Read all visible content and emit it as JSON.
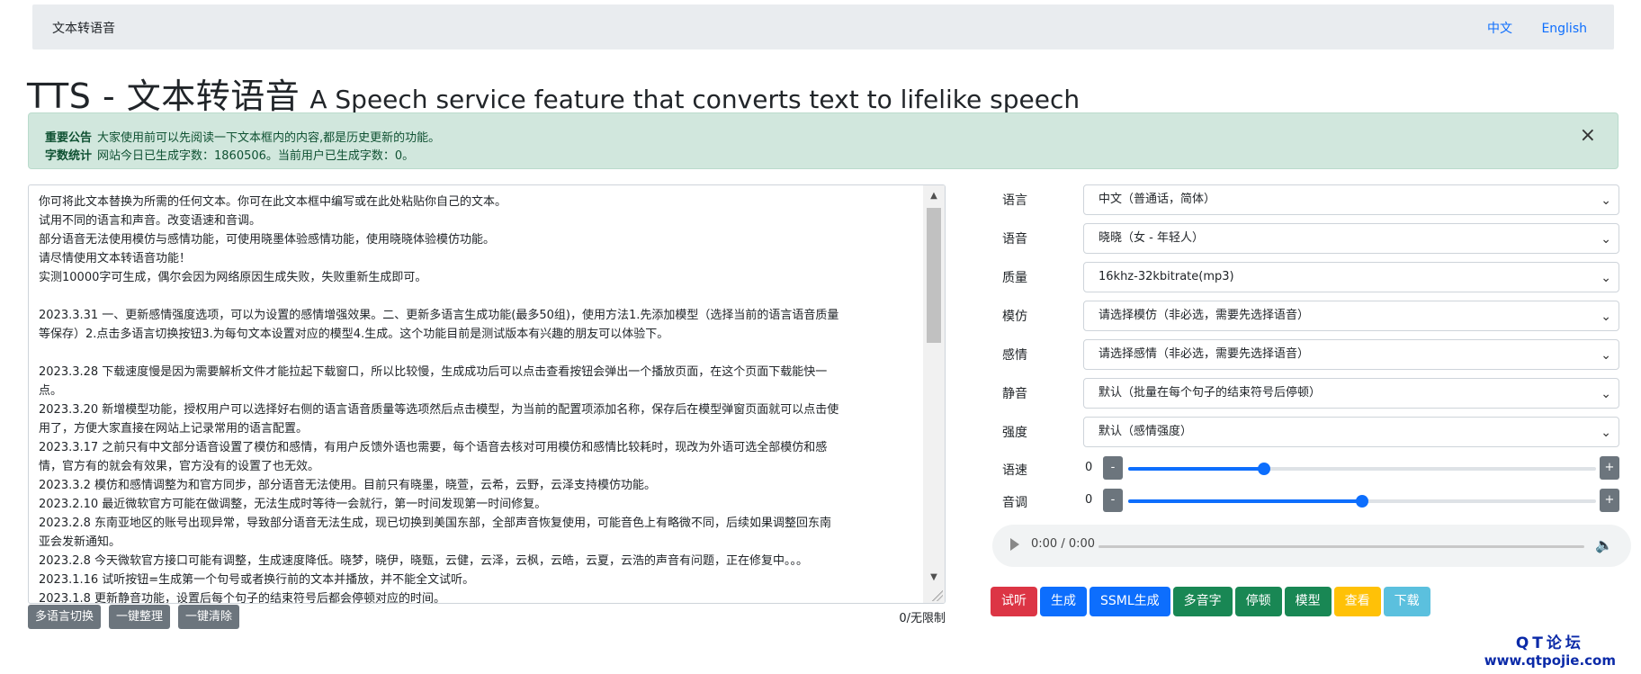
{
  "nav": {
    "brand": "文本转语音",
    "links": [
      "中文",
      "English"
    ]
  },
  "header": {
    "title": "TTS - 文本转语音",
    "subtitle": "A Speech service feature that converts text to lifelike speech"
  },
  "alert": {
    "notice_label": "重要公告",
    "notice_text": "大家使用前可以先阅读一下文本框内的内容,都是历史更新的功能。",
    "stats_label": "字数统计",
    "stats_text": "网站今日已生成字数：1860506。当前用户已生成字数：0。",
    "close": "×"
  },
  "textarea": {
    "lines": [
      "你可将此文本替换为所需的任何文本。你可在此文本框中编写或在此处粘贴你自己的文本。",
      "试用不同的语言和声音。改变语速和音调。",
      "部分语音无法使用模仿与感情功能，可使用晓墨体验感情功能，使用晓晓体验模仿功能。",
      "请尽情使用文本转语音功能！",
      "实测10000字可生成，偶尔会因为网络原因生成失败，失败重新生成即可。",
      "",
      "2023.3.31 一、更新感情强度选项，可以为设置的感情增强效果。二、更新多语言生成功能(最多50组)，使用方法1.先添加模型（选择当前的语言语音质量",
      "等保存）2.点击多语言切换按钮3.为每句文本设置对应的模型4.生成。这个功能目前是测试版本有兴趣的朋友可以体验下。",
      "",
      "2023.3.28 下载速度慢是因为需要解析文件才能拉起下载窗口，所以比较慢，生成成功后可以点击查看按钮会弹出一个播放页面，在这个页面下载能快一",
      "点。",
      "2023.3.20 新增模型功能，授权用户可以选择好右侧的语言语音质量等选项然后点击模型，为当前的配置项添加名称，保存后在模型弹窗页面就可以点击使",
      "用了，方便大家直接在网站上记录常用的语言配置。",
      "2023.3.17 之前只有中文部分语音设置了模仿和感情，有用户反馈外语也需要，每个语音去核对可用模仿和感情比较耗时，现改为外语可选全部模仿和感",
      "情，官方有的就会有效果，官方没有的设置了也无效。",
      "2023.3.2 模仿和感情调整为和官方同步，部分语音无法使用。目前只有晓墨，晓萱，云希，云野，云泽支持模仿功能。",
      "2023.2.10 最近微软官方可能在做调整，无法生成时等待一会就行，第一时间发现第一时间修复。",
      "2023.2.8 东南亚地区的账号出现异常，导致部分语音无法生成，现已切换到美国东部，全部声音恢复使用，可能音色上有略微不同，后续如果调整回东南",
      "亚会发新通知。",
      "2023.2.8 今天微软官方接口可能有调整，生成速度降低。晓梦，晓伊，晓甄，云健，云泽，云枫，云皓，云夏，云浩的声音有问题，正在修复中。。。",
      "2023.1.16 试听按钮=生成第一个句号或者换行前的文本并播放，并不能全文试听。",
      "2023.1.8 更新静音功能，设置后每个句子的结束符号后都会停顿对应的时间。"
    ],
    "char_count": "0/无限制"
  },
  "left_buttons": [
    "多语言切换",
    "一键整理",
    "一键清除"
  ],
  "settings": [
    {
      "label": "语言",
      "value": "中文（普通话，简体）"
    },
    {
      "label": "语音",
      "value": "晓晓（女 - 年轻人）"
    },
    {
      "label": "质量",
      "value": "16khz-32kbitrate(mp3)"
    },
    {
      "label": "模仿",
      "value": "请选择模仿（非必选，需要先选择语音）"
    },
    {
      "label": "感情",
      "value": "请选择感情（非必选，需要先选择语音）"
    },
    {
      "label": "静音",
      "value": "默认（批量在每个句子的结束符号后停顿）"
    },
    {
      "label": "强度",
      "value": "默认（感情强度）"
    }
  ],
  "sliders": [
    {
      "label": "语速",
      "value": "0",
      "minus": "-",
      "plus": "+",
      "position": 0.29
    },
    {
      "label": "音调",
      "value": "0",
      "minus": "-",
      "plus": "+",
      "position": 0.5
    }
  ],
  "audio": {
    "time": "0:00 / 0:00"
  },
  "actions": [
    {
      "label": "试听",
      "color": "#dc3545"
    },
    {
      "label": "生成",
      "color": "#0d6efd"
    },
    {
      "label": "SSML生成",
      "color": "#0d6efd"
    },
    {
      "label": "多音字",
      "color": "#198754"
    },
    {
      "label": "停顿",
      "color": "#198754"
    },
    {
      "label": "模型",
      "color": "#198754"
    },
    {
      "label": "查看",
      "color": "#ffc107"
    },
    {
      "label": "下载",
      "color": "#5bc0de"
    }
  ],
  "watermark": {
    "line1": "QT论坛",
    "line2": "www.qtpojie.com"
  }
}
